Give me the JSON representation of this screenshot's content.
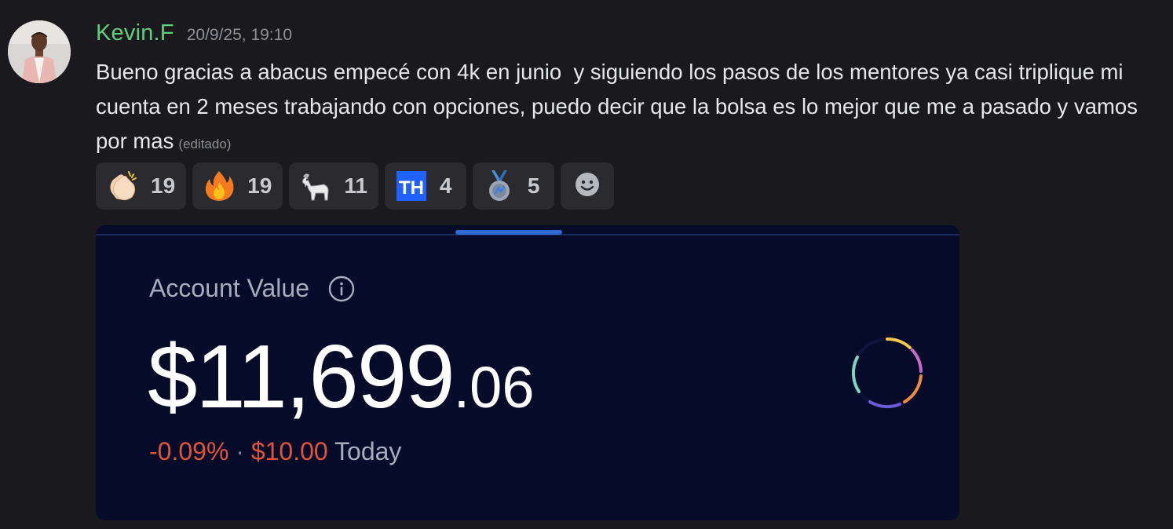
{
  "message": {
    "username": "Kevin.F",
    "timestamp": "20/9/25, 19:10",
    "text": "Bueno gracias a abacus empecé con 4k en junio  y siguiendo los pasos de los mentores ya casi triplique mi cuenta en 2 meses trabajando con opciones, puedo decir que la bolsa es lo mejor que me a pasado y vamos por mas",
    "edited_label": "(editado)",
    "username_color": "#5fcf7f"
  },
  "reactions": [
    {
      "icon": "clapping-hands-icon",
      "count": "19"
    },
    {
      "icon": "fire-icon",
      "count": "19"
    },
    {
      "icon": "goat-icon",
      "count": "11"
    },
    {
      "icon": "th-custom-emoji-icon",
      "icon_text": "TH",
      "count": "4"
    },
    {
      "icon": "medal-icon",
      "count": "5"
    }
  ],
  "add_reaction_icon": "smiley-add-reaction-icon",
  "attachment": {
    "account_label": "Account Value",
    "info_icon": "info-circle-icon",
    "value_whole": "$11,699",
    "value_cents": ".06",
    "change_percent": "-0.09%",
    "separator": "·",
    "change_amount": "$10.00",
    "period": "Today",
    "negative_color": "#e2533c",
    "background": "#050b28"
  }
}
